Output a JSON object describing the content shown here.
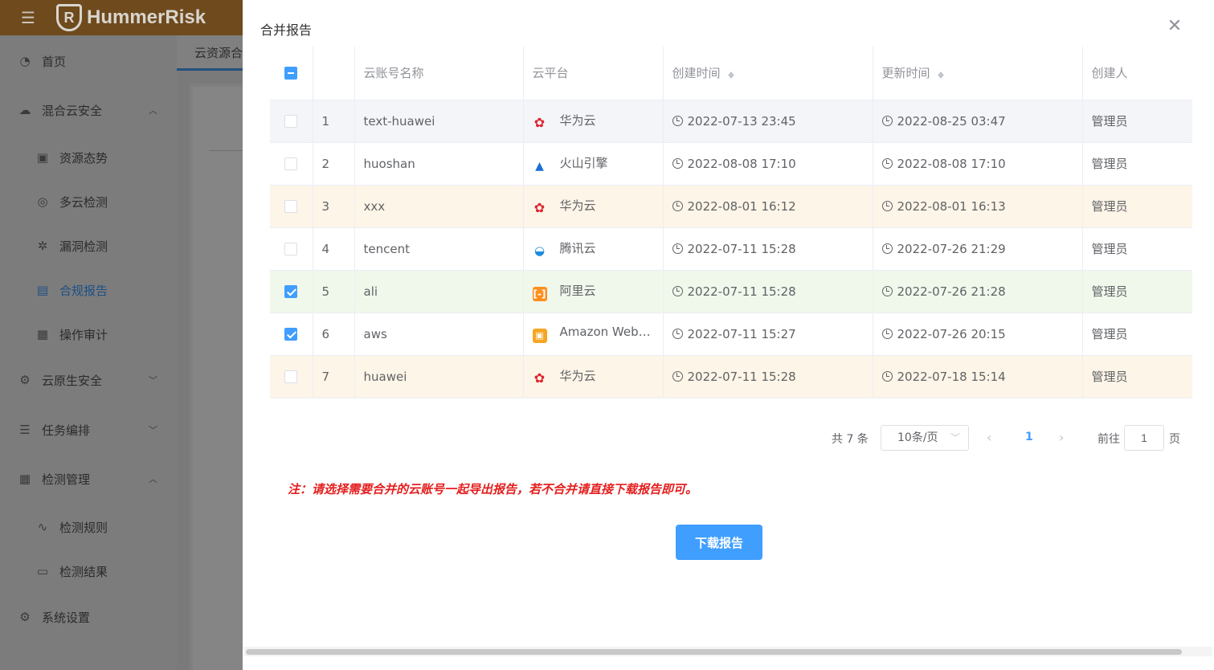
{
  "app": {
    "brand": "HummerRisk",
    "logo_letter": "R"
  },
  "sidebar": {
    "items": [
      {
        "label": "首页",
        "icon": "dashboard-icon"
      },
      {
        "label": "混合云安全",
        "icon": "cloud-icon",
        "expanded": true
      },
      {
        "label": "资源态势",
        "icon": "chart-icon"
      },
      {
        "label": "多云检测",
        "icon": "scan-icon"
      },
      {
        "label": "漏洞检测",
        "icon": "bug-icon"
      },
      {
        "label": "合规报告",
        "icon": "report-icon",
        "active": true
      },
      {
        "label": "操作审计",
        "icon": "audit-icon"
      },
      {
        "label": "云原生安全",
        "icon": "cloud-native-icon",
        "expanded": false
      },
      {
        "label": "任务编排",
        "icon": "list-icon",
        "expanded": false
      },
      {
        "label": "检测管理",
        "icon": "grid-icon",
        "expanded": true
      },
      {
        "label": "检测规则",
        "icon": "rule-icon"
      },
      {
        "label": "检测结果",
        "icon": "result-icon"
      },
      {
        "label": "系统设置",
        "icon": "gear-icon"
      }
    ]
  },
  "bg_tab": {
    "label": "云资源合"
  },
  "dialog": {
    "title": "合并报告",
    "close_icon": "close-icon",
    "table": {
      "headers": [
        "云账号名称",
        "云平台",
        "创建时间",
        "更新时间",
        "创建人"
      ],
      "rows": [
        {
          "index": "1",
          "name": "text-huawei",
          "platform": "华为云",
          "platform_icon": "huawei-icon",
          "created": "2022-07-13 23:45",
          "updated": "2022-08-25 03:47",
          "creator": "管理员",
          "checked": false,
          "row_state": "hover"
        },
        {
          "index": "2",
          "name": "huoshan",
          "platform": "火山引擎",
          "platform_icon": "volcengine-icon",
          "created": "2022-08-08 17:10",
          "updated": "2022-08-08 17:10",
          "creator": "管理员",
          "checked": false,
          "row_state": "normal"
        },
        {
          "index": "3",
          "name": "xxx",
          "platform": "华为云",
          "platform_icon": "huawei-icon",
          "created": "2022-08-01 16:12",
          "updated": "2022-08-01 16:13",
          "creator": "管理员",
          "checked": false,
          "row_state": "warning"
        },
        {
          "index": "4",
          "name": "tencent",
          "platform": "腾讯云",
          "platform_icon": "tencent-icon",
          "created": "2022-07-11 15:28",
          "updated": "2022-07-26 21:29",
          "creator": "管理员",
          "checked": false,
          "row_state": "normal"
        },
        {
          "index": "5",
          "name": "ali",
          "platform": "阿里云",
          "platform_icon": "aliyun-icon",
          "created": "2022-07-11 15:28",
          "updated": "2022-07-26 21:28",
          "creator": "管理员",
          "checked": true,
          "row_state": "success"
        },
        {
          "index": "6",
          "name": "aws",
          "platform": "Amazon Web ...",
          "platform_icon": "aws-icon",
          "created": "2022-07-11 15:27",
          "updated": "2022-07-26 20:15",
          "creator": "管理员",
          "checked": true,
          "row_state": "normal"
        },
        {
          "index": "7",
          "name": "huawei",
          "platform": "华为云",
          "platform_icon": "huawei-icon",
          "created": "2022-07-11 15:28",
          "updated": "2022-07-18 15:14",
          "creator": "管理员",
          "checked": false,
          "row_state": "warning"
        }
      ]
    },
    "pagination": {
      "total_text": "共 7 条",
      "page_size": "10条/页",
      "current_page": "1",
      "goto_label": "前往",
      "goto_value": "1",
      "goto_unit": "页"
    },
    "note": "注：请选择需要合并的云账号一起导出报告，若不合并请直接下载报告即可。",
    "download_button": "下载报告"
  },
  "colors": {
    "primary": "#409eff",
    "note_red": "#e41e1e",
    "header_brown": "#6e4a1d"
  }
}
